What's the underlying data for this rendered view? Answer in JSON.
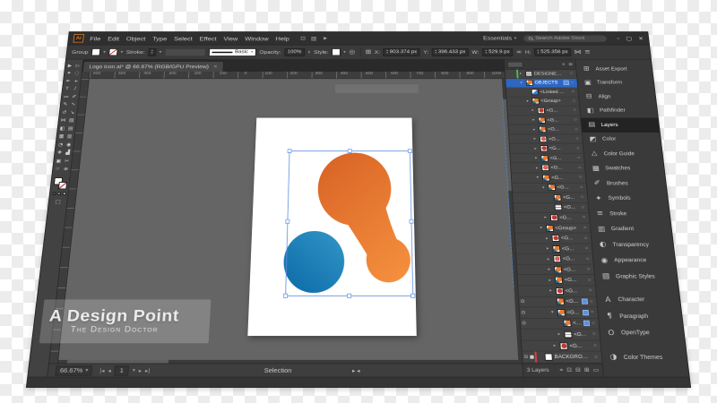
{
  "colors": {
    "accent_blue": "#5E8FE0",
    "selection_row": "#2F66C2",
    "orange_dark": "#D96426",
    "orange_main": "#EE7C2D",
    "orange_light": "#F79440",
    "blue_light": "#2F93C4",
    "blue_main": "#1678B0",
    "blue_dark": "#0C6BA8",
    "layer_green": "#44C944",
    "layer_red": "#E23B3B"
  },
  "window": {
    "minimize": "–",
    "maximize": "▢",
    "close": "×"
  },
  "menu_bar": {
    "logo": "Ai",
    "items": [
      "File",
      "Edit",
      "Object",
      "Type",
      "Select",
      "Effect",
      "View",
      "Window",
      "Help"
    ],
    "icons": [
      {
        "name": "touch-workspace-icon",
        "glyph": "⊡"
      },
      {
        "name": "arrange-documents-icon",
        "glyph": "▥"
      },
      {
        "name": "share-icon",
        "glyph": "➤"
      }
    ],
    "workspace": "Essentials",
    "search_placeholder": "Search Adobe Stock"
  },
  "control_bar": {
    "selection_label": "Group",
    "stroke_label": "Stroke:",
    "brush_name": "Basic",
    "opacity_label": "Opacity:",
    "opacity_value": "100%",
    "style_label": "Style:",
    "x_label": "X:",
    "x_value": "803.374 px",
    "y_label": "Y:",
    "y_value": "396.433 px",
    "w_label": "W:",
    "w_value": "529.9 px",
    "h_label": "H:",
    "h_value": "525.358 px"
  },
  "document_tab": {
    "title": "Logo icon.ai* @ 66.67% (RGB/GPU Preview)",
    "close": "×"
  },
  "ruler": {
    "labels": [
      "600",
      "500",
      "400",
      "300",
      "200",
      "100",
      "0",
      "100",
      "200",
      "300",
      "400",
      "500",
      "600",
      "700",
      "800",
      "900",
      "1000"
    ]
  },
  "toolbar": {
    "tools": [
      {
        "name": "selection-tool",
        "glyph": "▶"
      },
      {
        "name": "direct-selection-tool",
        "glyph": "▷"
      },
      {
        "name": "magic-wand-tool",
        "glyph": "✦"
      },
      {
        "name": "lasso-tool",
        "glyph": "◌"
      },
      {
        "name": "pen-tool",
        "glyph": "✒"
      },
      {
        "name": "add-anchor-tool",
        "glyph": "+"
      },
      {
        "name": "type-tool",
        "glyph": "T"
      },
      {
        "name": "line-tool",
        "glyph": "∕"
      },
      {
        "name": "rectangle-tool",
        "glyph": "▭"
      },
      {
        "name": "paintbrush-tool",
        "glyph": "✐"
      },
      {
        "name": "pencil-tool",
        "glyph": "✎"
      },
      {
        "name": "shaper-tool",
        "glyph": "∿"
      },
      {
        "name": "rotate-tool",
        "glyph": "↺"
      },
      {
        "name": "scale-tool",
        "glyph": "↘"
      },
      {
        "name": "width-tool",
        "glyph": "⋈"
      },
      {
        "name": "free-transform-tool",
        "glyph": "▨"
      },
      {
        "name": "shape-builder-tool",
        "glyph": "◧"
      },
      {
        "name": "perspective-grid-tool",
        "glyph": "▤"
      },
      {
        "name": "mesh-tool",
        "glyph": "▦"
      },
      {
        "name": "gradient-tool",
        "glyph": "▥"
      },
      {
        "name": "eyedropper-tool",
        "glyph": "◔"
      },
      {
        "name": "blend-tool",
        "glyph": "◉"
      },
      {
        "name": "symbol-sprayer-tool",
        "glyph": "❖"
      },
      {
        "name": "column-graph-tool",
        "glyph": "▟"
      },
      {
        "name": "artboard-tool",
        "glyph": "▣"
      },
      {
        "name": "slice-tool",
        "glyph": "✂"
      },
      {
        "name": "hand-tool",
        "glyph": "☞"
      },
      {
        "name": "zoom-tool",
        "glyph": "⊕"
      }
    ]
  },
  "canvas": {
    "watermark": {
      "title": "A Design Point",
      "subtitle": "The Design Doctor"
    }
  },
  "layers_panel": {
    "header_icons": [
      {
        "name": "collapse-panel-icon",
        "glyph": "«"
      },
      {
        "name": "panel-menu-icon",
        "glyph": "≡"
      }
    ],
    "rows": [
      {
        "name": "DESIGNED BY...",
        "exp": "▸",
        "thumb": "designed",
        "indent": 0,
        "bar": "green"
      },
      {
        "name": "OBJECTS",
        "exp": "▾",
        "thumb": "logo",
        "indent": 0,
        "selected": true,
        "chip": true
      },
      {
        "name": "<Linked ...",
        "thumb": "file",
        "indent": 1
      },
      {
        "name": "<Group>",
        "exp": "▾",
        "thumb": "logo",
        "indent": 1
      },
      {
        "name": "<G...",
        "exp": "▸",
        "thumb": "red",
        "indent": 2
      },
      {
        "name": "<G...",
        "exp": "▸",
        "thumb": "logo",
        "indent": 2
      },
      {
        "name": "<G...",
        "exp": "▸",
        "thumb": "logo",
        "indent": 2
      },
      {
        "name": "<G...",
        "exp": "▸",
        "thumb": "pink",
        "indent": 2
      },
      {
        "name": "<G...",
        "exp": "▸",
        "thumb": "red",
        "indent": 2
      },
      {
        "name": "<G...",
        "exp": "▸",
        "thumb": "logo",
        "indent": 2
      },
      {
        "name": "<G...",
        "exp": "▸",
        "thumb": "pink",
        "indent": 2
      },
      {
        "name": "<G...",
        "exp": "▾",
        "thumb": "logo",
        "indent": 2
      },
      {
        "name": "<G...",
        "exp": "▾",
        "thumb": "logo",
        "indent": 3
      },
      {
        "name": "<G...",
        "thumb": "logo",
        "indent": 4
      },
      {
        "name": "<G...",
        "thumb": "stripes",
        "indent": 4
      },
      {
        "name": "<G...",
        "exp": "▸",
        "thumb": "red",
        "indent": 3
      },
      {
        "name": "<Group>",
        "exp": "▾",
        "thumb": "logo",
        "indent": 2
      },
      {
        "name": "<G...",
        "exp": "▸",
        "thumb": "red",
        "indent": 3
      },
      {
        "name": "<G...",
        "exp": "▸",
        "thumb": "logo",
        "indent": 3
      },
      {
        "name": "<G...",
        "exp": "▸",
        "thumb": "pink",
        "indent": 3
      },
      {
        "name": "<G...",
        "exp": "▸",
        "thumb": "logo",
        "indent": 3
      },
      {
        "name": "<G...",
        "exp": "▸",
        "thumb": "logo",
        "indent": 3
      },
      {
        "name": "<G...",
        "exp": "▸",
        "thumb": "red",
        "indent": 3
      },
      {
        "name": "<G...",
        "thumb": "logo",
        "indent": 3,
        "eye": true,
        "chip": true
      },
      {
        "name": "<G...",
        "exp": "▾",
        "thumb": "logo",
        "indent": 3,
        "eye": true,
        "chip": true
      },
      {
        "name": "<G...",
        "thumb": "logo",
        "indent": 4,
        "eye": true,
        "chip": true
      },
      {
        "name": "<G...",
        "exp": "▸",
        "thumb": "stripes",
        "indent": 4
      },
      {
        "name": "<G...",
        "exp": "▸",
        "thumb": "red",
        "indent": 3
      },
      {
        "name": "BACKGROUND",
        "thumb": "white",
        "indent": 0,
        "eye": true,
        "lock": true,
        "bar": "red"
      }
    ],
    "footer": {
      "count": "3 Layers",
      "icons": [
        {
          "name": "locate-object-icon",
          "glyph": "⌖"
        },
        {
          "name": "clipping-mask-icon",
          "glyph": "⊡"
        },
        {
          "name": "new-sublayer-icon",
          "glyph": "⊟"
        },
        {
          "name": "new-layer-icon",
          "glyph": "⊞"
        },
        {
          "name": "delete-layer-icon",
          "glyph": "▭"
        }
      ]
    }
  },
  "dock": {
    "items": [
      {
        "name": "dock-item-asset-export",
        "label": "Asset Export",
        "glyph": "⊞"
      },
      {
        "name": "dock-item-transform",
        "label": "Transform",
        "glyph": "▣"
      },
      {
        "name": "dock-item-align",
        "label": "Align",
        "glyph": "⊟"
      },
      {
        "name": "dock-item-pathfinder",
        "label": "Pathfinder",
        "glyph": "◧"
      },
      {
        "name": "dock-item-layers",
        "label": "Layers",
        "glyph": "▤",
        "active": true
      },
      {
        "name": "dock-item-color",
        "label": "Color",
        "glyph": "◩"
      },
      {
        "name": "dock-item-color-guide",
        "label": "Color Guide",
        "glyph": "△"
      },
      {
        "name": "dock-item-swatches",
        "label": "Swatches",
        "glyph": "▦"
      },
      {
        "name": "dock-item-brushes",
        "label": "Brushes",
        "glyph": "✐"
      },
      {
        "name": "dock-item-symbols",
        "label": "Symbols",
        "glyph": "✦"
      },
      {
        "name": "dock-item-stroke",
        "label": "Stroke",
        "glyph": "≡"
      },
      {
        "name": "dock-item-gradient",
        "label": "Gradient",
        "glyph": "▥"
      },
      {
        "name": "dock-item-transparency",
        "label": "Transparency",
        "glyph": "◐"
      },
      {
        "name": "dock-item-appearance",
        "label": "Appearance",
        "glyph": "◉"
      },
      {
        "name": "dock-item-graphic-styles",
        "label": "Graphic Styles",
        "glyph": "▧"
      },
      {
        "name": "dock-item-character",
        "label": "Character",
        "glyph": "A",
        "gap": true
      },
      {
        "name": "dock-item-paragraph",
        "label": "Paragraph",
        "glyph": "¶"
      },
      {
        "name": "dock-item-opentype",
        "label": "OpenType",
        "glyph": "O"
      },
      {
        "name": "dock-item-color-themes",
        "label": "Color Themes",
        "glyph": "◑",
        "gap": true
      }
    ]
  },
  "status_bar": {
    "zoom": "66.67%",
    "nav_first": "|◂",
    "nav_prev": "◂",
    "artboard_number": "1",
    "nav_next": "▸",
    "nav_last": "▸|",
    "tool_label": "Selection",
    "arrows": "▸ ◂"
  }
}
